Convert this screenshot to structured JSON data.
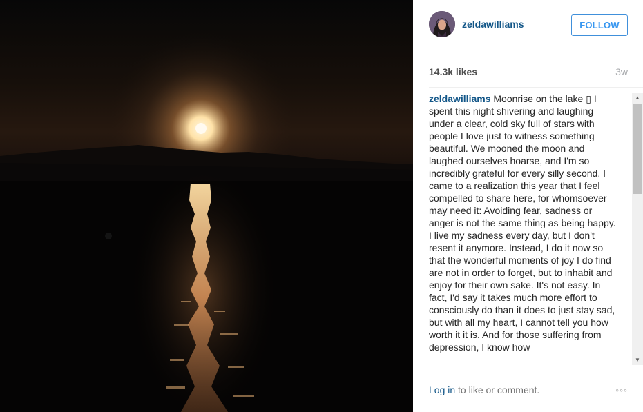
{
  "post": {
    "photo_alt": "Moonrise over a lake at night"
  },
  "header": {
    "username": "zeldawilliams",
    "follow_label": "FOLLOW"
  },
  "stats": {
    "likes": "14.3k likes",
    "age": "3w"
  },
  "caption": {
    "username": "zeldawilliams",
    "text": " Moonrise on the lake ▯ I spent this night shivering and laughing under a clear, cold sky full of stars with people I love just to witness something beautiful. We mooned the moon and laughed ourselves hoarse, and I'm so incredibly grateful for every silly second. I came to a realization this year that I feel compelled to share here, for whomsoever may need it: Avoiding fear, sadness or anger is not the same thing as being happy. I live my sadness every day, but I don't resent it anymore. Instead, I do it now so that the wonderful moments of joy I do find are not in order to forget, but to inhabit and enjoy for their own sake. It's not easy. In fact, I'd say it takes much more effort to consciously do than it does to just stay sad, but with all my heart, I cannot tell you how worth it it is. And for those suffering from depression, I know how"
  },
  "scrollbar": {
    "up_glyph": "▲",
    "down_glyph": "▼"
  },
  "footer": {
    "login_label": "Log in",
    "rest_text": " to like or comment.",
    "more_glyph": "◦◦◦"
  },
  "colors": {
    "link": "#125688",
    "follow": "#3897f0"
  }
}
